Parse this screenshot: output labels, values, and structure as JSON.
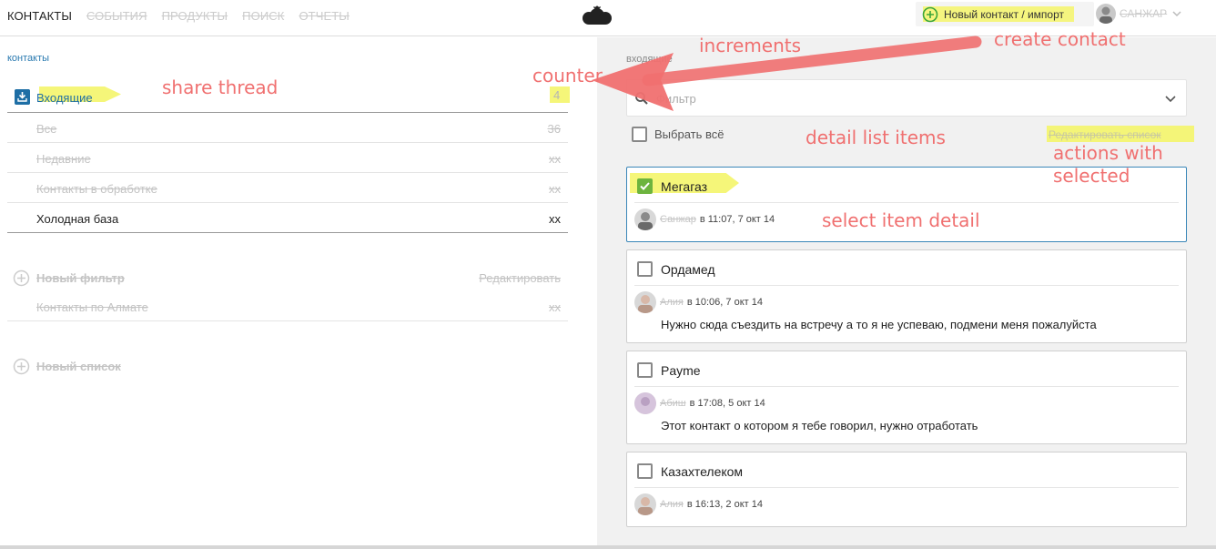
{
  "topnav": {
    "tabs": [
      "КОНТАКТЫ",
      "СОБЫТИЯ",
      "ПРОДУКТЫ",
      "ПОИСК",
      "ОТЧЕТЫ"
    ],
    "create_label": "Новый контакт / импорт",
    "user_name": "САНЖАР"
  },
  "sidebar": {
    "breadcrumb": "контакты",
    "inbox": {
      "label": "Входящие",
      "count": "4"
    },
    "subitems": [
      {
        "label": "Все",
        "count": "36"
      },
      {
        "label": "Недавние",
        "count": "xx"
      },
      {
        "label": "Контакты в обработке",
        "count": "xx"
      },
      {
        "label": "Холодная база",
        "count": "xx"
      }
    ],
    "new_filter_label": "Новый фильтр",
    "edit_label": "Редактировать",
    "filter_items": [
      {
        "label": "Контакты по Алмате",
        "count": "xx"
      }
    ],
    "new_list_label": "Новый список"
  },
  "main": {
    "section_title": "входящие",
    "filter_placeholder": "Фильтр",
    "select_all_label": "Выбрать всё",
    "edit_list_label": "Редактировать список",
    "cards": [
      {
        "name": "Мегагаз",
        "author": "Санжар",
        "time": "в 11:07, 7 окт 14",
        "message": "",
        "checked": true
      },
      {
        "name": "Ордамед",
        "author": "Алия",
        "time": "в 10:06, 7 окт 14",
        "message": "Нужно сюда съездить на встречу а то я не успеваю, подмени меня пожалуйста",
        "checked": false
      },
      {
        "name": "Payme",
        "author": "Абиш",
        "time": "в 17:08, 5 окт 14",
        "message": "Этот контакт о котором я тебе говорил, нужно отработать",
        "checked": false
      },
      {
        "name": "Казахтелеком",
        "author": "Алия",
        "time": "в 16:13, 2 окт 14",
        "message": "",
        "checked": false
      }
    ]
  },
  "annotations": {
    "increments": "increments",
    "create_contact": "create contact",
    "counter": "counter",
    "share_thread": "share thread",
    "detail_list_items": "detail list items",
    "actions_with_selected_1": "actions with",
    "actions_with_selected_2": "selected",
    "select_item_detail": "select item detail"
  },
  "colors": {
    "accent_blue": "#1e6ea5",
    "highlight_yellow": "#f4f56a",
    "annotation_red": "#f07070",
    "check_green": "#6db43e"
  },
  "icons": {
    "logo": "cloud-logo-icon",
    "create": "plus-circle-icon",
    "user_menu": "chevron-down-icon",
    "inbox": "inbox-download-icon",
    "search": "search-icon",
    "filter_dropdown": "chevron-down-icon",
    "add": "plus-circle-icon"
  }
}
